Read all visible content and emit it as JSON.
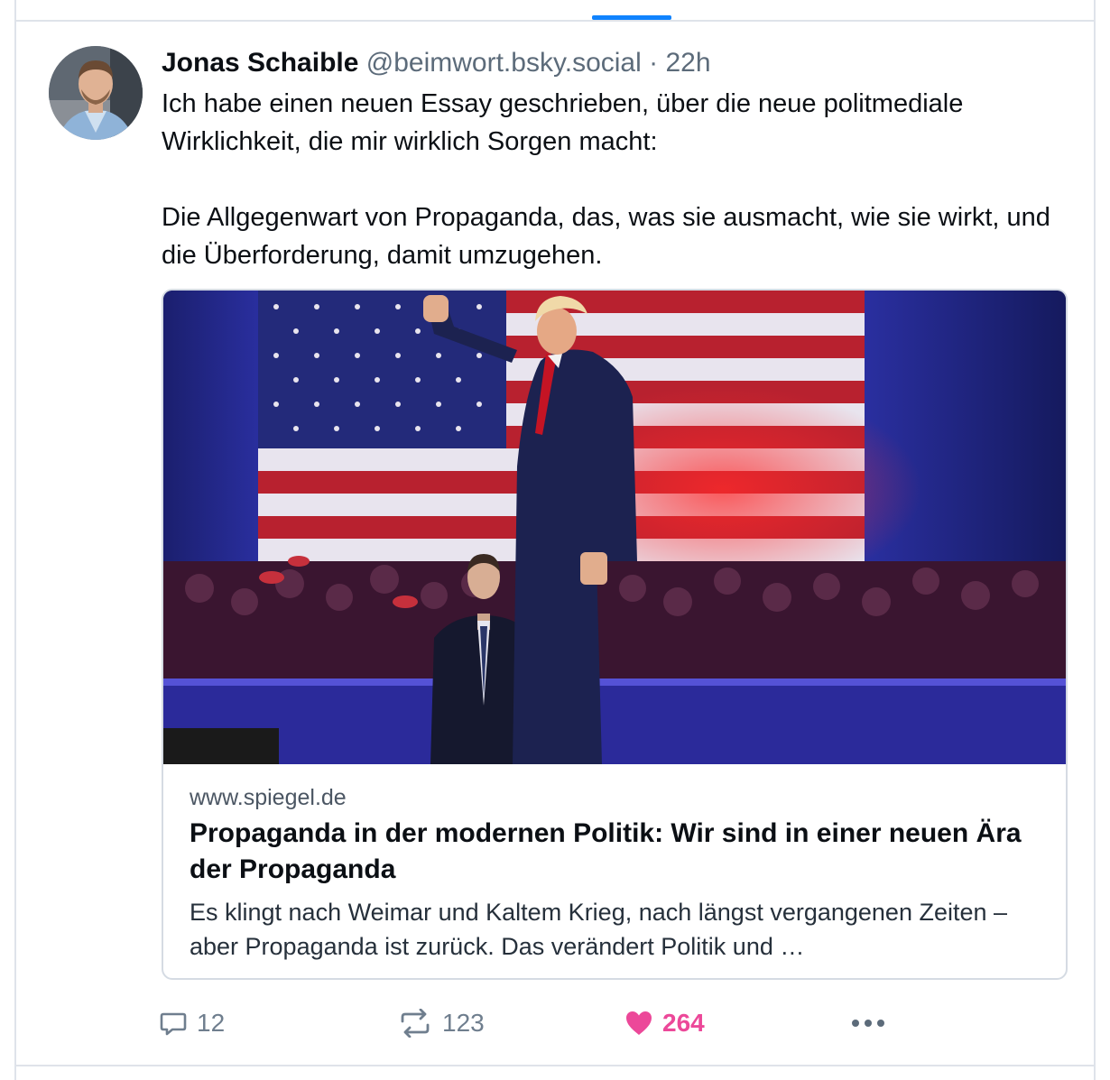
{
  "post": {
    "author_name": "Jonas Schaible",
    "author_handle": "@beimwort.bsky.social",
    "separator": "·",
    "time": "22h",
    "text_paragraph_1": "Ich habe einen neuen Essay geschrieben, über die neue politmediale Wirklichkeit, die mir wirklich Sorgen macht:",
    "text_paragraph_2": "Die Allgegenwart von Propaganda, das, was sie ausmacht, wie sie wirkt, und die Überforderung, damit umzugehen."
  },
  "link_card": {
    "domain": "www.spiegel.de",
    "title": "Propaganda in der modernen Politik: Wir sind in einer neuen Ära der Propaganda",
    "description": "Es klingt nach Weimar und Kaltem Krieg, nach längst vergangenen Zeiten – aber Propaganda ist zurück. Das verändert Politik und …"
  },
  "actions": {
    "reply_count": "12",
    "repost_count": "123",
    "like_count": "264",
    "reply_icon": "speech-bubble-icon",
    "repost_icon": "repost-arrows-icon",
    "like_icon": "heart-icon",
    "more_icon": "ellipsis-icon"
  },
  "colors": {
    "accent": "#1083fe",
    "like": "#ec4899",
    "muted": "#5c6b7a",
    "border": "#dfe3ea"
  }
}
